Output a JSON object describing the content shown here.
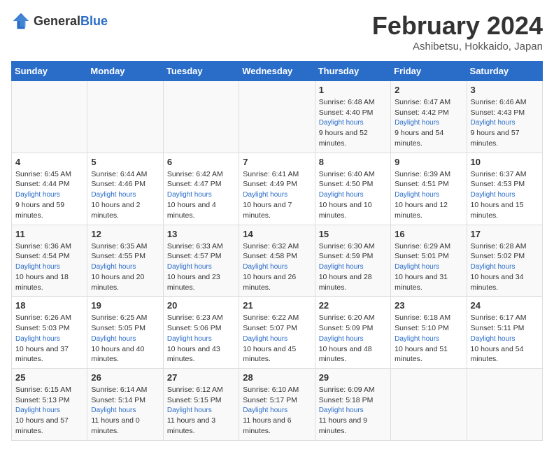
{
  "header": {
    "logo_general": "General",
    "logo_blue": "Blue",
    "month_title": "February 2024",
    "location": "Ashibetsu, Hokkaido, Japan"
  },
  "weekdays": [
    "Sunday",
    "Monday",
    "Tuesday",
    "Wednesday",
    "Thursday",
    "Friday",
    "Saturday"
  ],
  "weeks": [
    [
      {
        "day": "",
        "info": ""
      },
      {
        "day": "",
        "info": ""
      },
      {
        "day": "",
        "info": ""
      },
      {
        "day": "",
        "info": ""
      },
      {
        "day": "1",
        "sunrise": "Sunrise: 6:48 AM",
        "sunset": "Sunset: 4:40 PM",
        "daylight": "Daylight: 9 hours and 52 minutes."
      },
      {
        "day": "2",
        "sunrise": "Sunrise: 6:47 AM",
        "sunset": "Sunset: 4:42 PM",
        "daylight": "Daylight: 9 hours and 54 minutes."
      },
      {
        "day": "3",
        "sunrise": "Sunrise: 6:46 AM",
        "sunset": "Sunset: 4:43 PM",
        "daylight": "Daylight: 9 hours and 57 minutes."
      }
    ],
    [
      {
        "day": "4",
        "sunrise": "Sunrise: 6:45 AM",
        "sunset": "Sunset: 4:44 PM",
        "daylight": "Daylight: 9 hours and 59 minutes."
      },
      {
        "day": "5",
        "sunrise": "Sunrise: 6:44 AM",
        "sunset": "Sunset: 4:46 PM",
        "daylight": "Daylight: 10 hours and 2 minutes."
      },
      {
        "day": "6",
        "sunrise": "Sunrise: 6:42 AM",
        "sunset": "Sunset: 4:47 PM",
        "daylight": "Daylight: 10 hours and 4 minutes."
      },
      {
        "day": "7",
        "sunrise": "Sunrise: 6:41 AM",
        "sunset": "Sunset: 4:49 PM",
        "daylight": "Daylight: 10 hours and 7 minutes."
      },
      {
        "day": "8",
        "sunrise": "Sunrise: 6:40 AM",
        "sunset": "Sunset: 4:50 PM",
        "daylight": "Daylight: 10 hours and 10 minutes."
      },
      {
        "day": "9",
        "sunrise": "Sunrise: 6:39 AM",
        "sunset": "Sunset: 4:51 PM",
        "daylight": "Daylight: 10 hours and 12 minutes."
      },
      {
        "day": "10",
        "sunrise": "Sunrise: 6:37 AM",
        "sunset": "Sunset: 4:53 PM",
        "daylight": "Daylight: 10 hours and 15 minutes."
      }
    ],
    [
      {
        "day": "11",
        "sunrise": "Sunrise: 6:36 AM",
        "sunset": "Sunset: 4:54 PM",
        "daylight": "Daylight: 10 hours and 18 minutes."
      },
      {
        "day": "12",
        "sunrise": "Sunrise: 6:35 AM",
        "sunset": "Sunset: 4:55 PM",
        "daylight": "Daylight: 10 hours and 20 minutes."
      },
      {
        "day": "13",
        "sunrise": "Sunrise: 6:33 AM",
        "sunset": "Sunset: 4:57 PM",
        "daylight": "Daylight: 10 hours and 23 minutes."
      },
      {
        "day": "14",
        "sunrise": "Sunrise: 6:32 AM",
        "sunset": "Sunset: 4:58 PM",
        "daylight": "Daylight: 10 hours and 26 minutes."
      },
      {
        "day": "15",
        "sunrise": "Sunrise: 6:30 AM",
        "sunset": "Sunset: 4:59 PM",
        "daylight": "Daylight: 10 hours and 28 minutes."
      },
      {
        "day": "16",
        "sunrise": "Sunrise: 6:29 AM",
        "sunset": "Sunset: 5:01 PM",
        "daylight": "Daylight: 10 hours and 31 minutes."
      },
      {
        "day": "17",
        "sunrise": "Sunrise: 6:28 AM",
        "sunset": "Sunset: 5:02 PM",
        "daylight": "Daylight: 10 hours and 34 minutes."
      }
    ],
    [
      {
        "day": "18",
        "sunrise": "Sunrise: 6:26 AM",
        "sunset": "Sunset: 5:03 PM",
        "daylight": "Daylight: 10 hours and 37 minutes."
      },
      {
        "day": "19",
        "sunrise": "Sunrise: 6:25 AM",
        "sunset": "Sunset: 5:05 PM",
        "daylight": "Daylight: 10 hours and 40 minutes."
      },
      {
        "day": "20",
        "sunrise": "Sunrise: 6:23 AM",
        "sunset": "Sunset: 5:06 PM",
        "daylight": "Daylight: 10 hours and 43 minutes."
      },
      {
        "day": "21",
        "sunrise": "Sunrise: 6:22 AM",
        "sunset": "Sunset: 5:07 PM",
        "daylight": "Daylight: 10 hours and 45 minutes."
      },
      {
        "day": "22",
        "sunrise": "Sunrise: 6:20 AM",
        "sunset": "Sunset: 5:09 PM",
        "daylight": "Daylight: 10 hours and 48 minutes."
      },
      {
        "day": "23",
        "sunrise": "Sunrise: 6:18 AM",
        "sunset": "Sunset: 5:10 PM",
        "daylight": "Daylight: 10 hours and 51 minutes."
      },
      {
        "day": "24",
        "sunrise": "Sunrise: 6:17 AM",
        "sunset": "Sunset: 5:11 PM",
        "daylight": "Daylight: 10 hours and 54 minutes."
      }
    ],
    [
      {
        "day": "25",
        "sunrise": "Sunrise: 6:15 AM",
        "sunset": "Sunset: 5:13 PM",
        "daylight": "Daylight: 10 hours and 57 minutes."
      },
      {
        "day": "26",
        "sunrise": "Sunrise: 6:14 AM",
        "sunset": "Sunset: 5:14 PM",
        "daylight": "Daylight: 11 hours and 0 minutes."
      },
      {
        "day": "27",
        "sunrise": "Sunrise: 6:12 AM",
        "sunset": "Sunset: 5:15 PM",
        "daylight": "Daylight: 11 hours and 3 minutes."
      },
      {
        "day": "28",
        "sunrise": "Sunrise: 6:10 AM",
        "sunset": "Sunset: 5:17 PM",
        "daylight": "Daylight: 11 hours and 6 minutes."
      },
      {
        "day": "29",
        "sunrise": "Sunrise: 6:09 AM",
        "sunset": "Sunset: 5:18 PM",
        "daylight": "Daylight: 11 hours and 9 minutes."
      },
      {
        "day": "",
        "info": ""
      },
      {
        "day": "",
        "info": ""
      }
    ]
  ]
}
